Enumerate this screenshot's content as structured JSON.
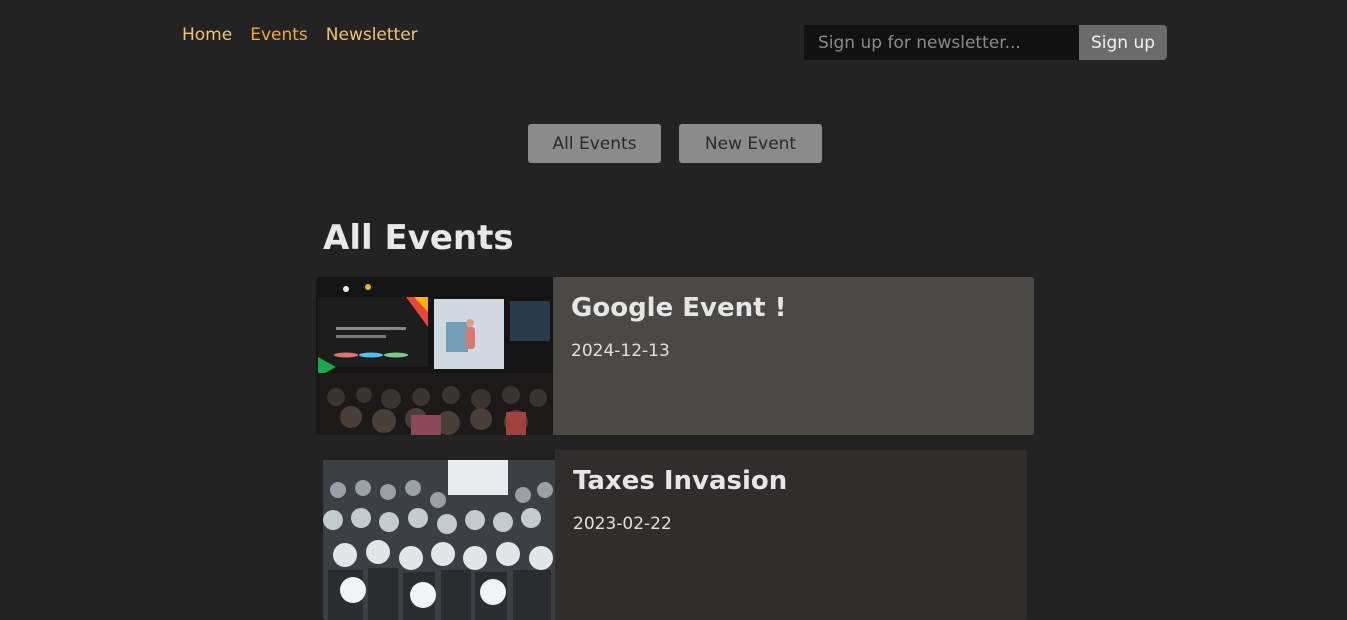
{
  "nav": {
    "home": "Home",
    "events": "Events",
    "newsletter": "Newsletter"
  },
  "newsletter_form": {
    "placeholder": "Sign up for newsletter...",
    "button": "Sign up"
  },
  "actions": {
    "all_events": "All Events",
    "new_event": "New Event"
  },
  "page_title": "All Events",
  "events": [
    {
      "title": "Google Event !",
      "date": "2024-12-13"
    },
    {
      "title": "Taxes Invasion",
      "date": "2023-02-22"
    }
  ],
  "colors": {
    "background": "#232323",
    "nav_link": "#f3c56a",
    "nav_active": "#f0a83c",
    "card_highlight": "#4a4946",
    "card": "#2f2e2c"
  }
}
